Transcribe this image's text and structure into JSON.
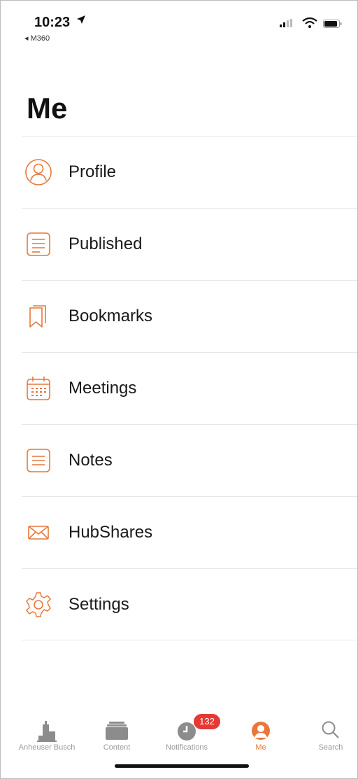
{
  "status_bar": {
    "time": "10:23",
    "back_app": "◂ M360"
  },
  "page": {
    "title": "Me"
  },
  "accent_color": "#e8773a",
  "menu": [
    {
      "label": "Profile",
      "icon": "person-icon"
    },
    {
      "label": "Published",
      "icon": "document-icon"
    },
    {
      "label": "Bookmarks",
      "icon": "bookmark-icon"
    },
    {
      "label": "Meetings",
      "icon": "calendar-icon"
    },
    {
      "label": "Notes",
      "icon": "notes-icon"
    },
    {
      "label": "HubShares",
      "icon": "envelope-icon"
    },
    {
      "label": "Settings",
      "icon": "gear-icon"
    }
  ],
  "tabbar": {
    "tabs": [
      {
        "label": "Anheuser Busch",
        "icon": "building-icon"
      },
      {
        "label": "Content",
        "icon": "stack-icon"
      },
      {
        "label": "Notifications",
        "icon": "clock-icon",
        "badge": "132"
      },
      {
        "label": "Me",
        "icon": "person-icon",
        "active": true
      },
      {
        "label": "Search",
        "icon": "search-icon"
      }
    ]
  }
}
